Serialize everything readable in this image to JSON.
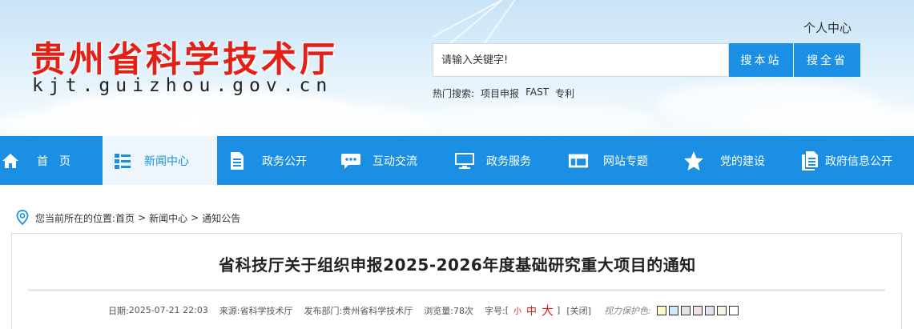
{
  "header": {
    "site_title": "贵州省科学技术厅",
    "site_domain": "kjt.guizhou.gov.cn",
    "personal_center": "个人中心",
    "search": {
      "placeholder": "请输入关键字!",
      "btn_site": "搜本站",
      "btn_province": "搜全省"
    },
    "hot": {
      "label": "热门搜索:",
      "words": [
        "项目申报",
        "FAST",
        "专利"
      ]
    }
  },
  "nav": {
    "items": [
      {
        "label": "首　页",
        "icon": "home-icon"
      },
      {
        "label": "新闻中心",
        "icon": "list-icon",
        "active": true
      },
      {
        "label": "政务公开",
        "icon": "document-icon"
      },
      {
        "label": "互动交流",
        "icon": "chat-icon"
      },
      {
        "label": "政务服务",
        "icon": "monitor-icon"
      },
      {
        "label": "网站专题",
        "icon": "window-icon"
      },
      {
        "label": "党的建设",
        "icon": "star-icon"
      },
      {
        "label": "政府信息公开",
        "icon": "files-icon"
      }
    ]
  },
  "breadcrumb": {
    "prefix": "您当前所在的位置:",
    "home": "首页",
    "news": "新闻中心",
    "current": "通知公告",
    "separator": ">"
  },
  "article": {
    "title": "省科技厅关于组织申报2025-2026年度基础研究重大项目的通知",
    "date_label": "日期:",
    "date": "2025-07-21 22:03",
    "source_label": "来源:",
    "source": "省科学技术厅",
    "dept_label": "发布部门:",
    "dept": "贵州省科学技术厅",
    "views_label": "浏览量:",
    "views": "78次",
    "font_label": "字号:",
    "bracket_open": "[",
    "font_small": "小",
    "font_mid": "中",
    "font_big": "大",
    "bracket_close": "]",
    "close": "[关闭]",
    "eye_label": "视力保护色:",
    "swatches": [
      "#fff8c8",
      "#cde8f6",
      "#e3e3e3",
      "#f3dde8",
      "#e6e0f6",
      "#eef7e6",
      "#ffffff"
    ]
  },
  "colors": {
    "brand_blue": "#1a8fe3",
    "title_red": "#e32018"
  }
}
